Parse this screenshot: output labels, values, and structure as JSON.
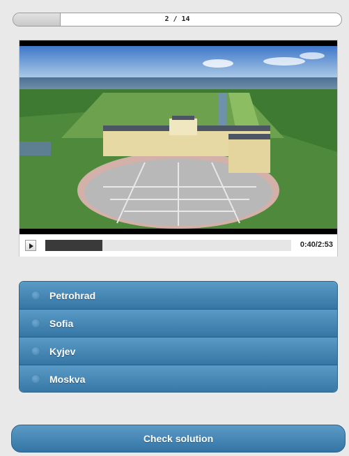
{
  "progress": {
    "text": "2 / 14",
    "current": 2,
    "total": 14
  },
  "player": {
    "time": "0:40/2:53",
    "position_seconds": 40,
    "duration_seconds": 173,
    "play_icon": "play-icon"
  },
  "options": [
    {
      "label": "Petrohrad"
    },
    {
      "label": "Sofia"
    },
    {
      "label": "Kyjev"
    },
    {
      "label": "Moskva"
    }
  ],
  "check_button": {
    "label": "Check solution"
  },
  "colors": {
    "accent": "#3f80b0",
    "accent_dark": "#2e6287",
    "background": "#e9e9e9"
  }
}
